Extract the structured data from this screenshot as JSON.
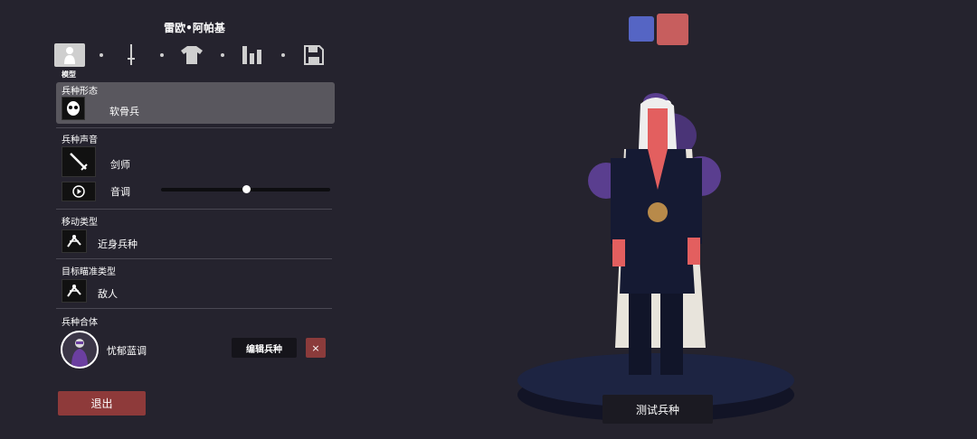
{
  "unit_name": "雷欧•阿帕基",
  "tabs": {
    "items": [
      {
        "icon": "person-icon",
        "active": true
      },
      {
        "icon": "sword-icon",
        "active": false
      },
      {
        "icon": "shirt-icon",
        "active": false
      },
      {
        "icon": "bar-chart-icon",
        "active": false
      },
      {
        "icon": "save-icon",
        "active": false
      }
    ],
    "active_label": "模型"
  },
  "sections": {
    "form": {
      "label": "兵种形态",
      "value": "软骨兵",
      "icon": "mask-icon"
    },
    "voice": {
      "label": "兵种声音",
      "value": "剑师",
      "icon": "sword-icon",
      "pitch_label": "音调",
      "pitch_value": 0.5
    },
    "movement": {
      "label": "移动类型",
      "value": "近身兵种",
      "icon": "melee-icon"
    },
    "targeting": {
      "label": "目标瞄准类型",
      "value": "敌人",
      "icon": "target-enemy-icon"
    },
    "combination": {
      "label": "兵种合体",
      "value": "忧郁蓝调",
      "edit_label": "编辑兵种",
      "remove_label": "×"
    }
  },
  "exit_label": "退出",
  "test_label": "测试兵种",
  "team_colors": {
    "blue": "#5565c4",
    "red": "#c75e5e"
  }
}
